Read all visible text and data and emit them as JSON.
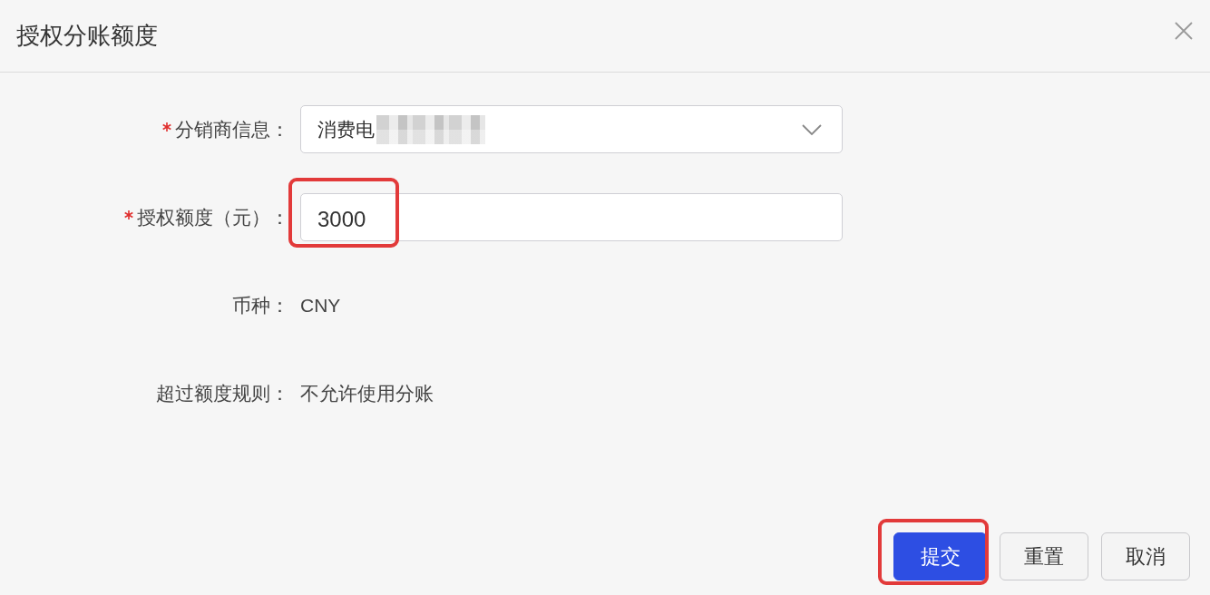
{
  "dialog": {
    "title": "授权分账额度"
  },
  "fields": [
    {
      "kind": "select",
      "label": "分销商信息：",
      "required": true,
      "value": "消费电",
      "redacted": true
    },
    {
      "kind": "input",
      "label": "授权额度（元）：",
      "required": true,
      "value": "3000",
      "highlighted": true
    },
    {
      "kind": "text",
      "label": "币种：",
      "value": "CNY"
    },
    {
      "kind": "text",
      "label": "超过额度规则：",
      "value": "不允许使用分账"
    }
  ],
  "buttons": [
    {
      "label": "提交",
      "primary": true,
      "highlighted": true
    },
    {
      "label": "重置",
      "primary": false,
      "highlighted": false
    },
    {
      "label": "取消",
      "primary": false,
      "highlighted": false
    }
  ]
}
